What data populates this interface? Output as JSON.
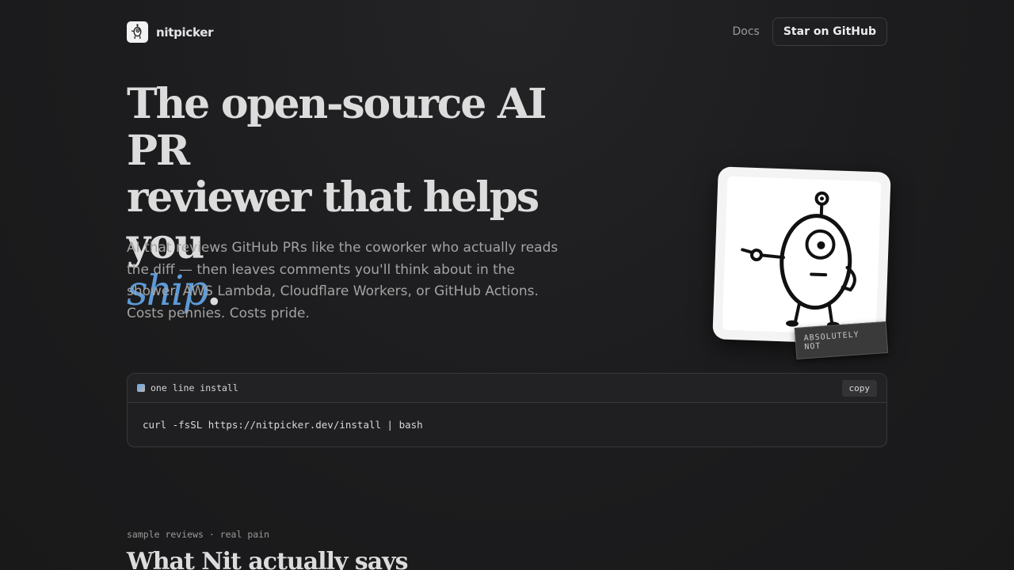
{
  "brand": {
    "name": "nitpicker",
    "logo_icon": "robot-logo-icon"
  },
  "nav": {
    "docs_label": "Docs",
    "star_label": "Star on GitHub"
  },
  "hero": {
    "title_line1": "The open-source AI PR",
    "title_line2": "reviewer that helps you",
    "title_accent": "ship",
    "title_period": ".",
    "subtitle": "AI that reviews GitHub PRs like the coworker who actually reads the diff — then leaves comments you'll think about in the shower. AWS Lambda, Cloudflare Workers, or GitHub Actions. Costs pennies. Costs pride.",
    "accent_color": "#5d9bd8"
  },
  "sticker": {
    "illustration_icon": "pointing-robot-icon",
    "tag": "ABSOLUTELY NOT"
  },
  "install": {
    "label": "one line install",
    "copy_label": "copy",
    "command": "curl -fsSL https://nitpicker.dev/install | bash"
  },
  "reviews": {
    "eyebrow": "sample reviews · real pain",
    "title": "What Nit actually says"
  }
}
